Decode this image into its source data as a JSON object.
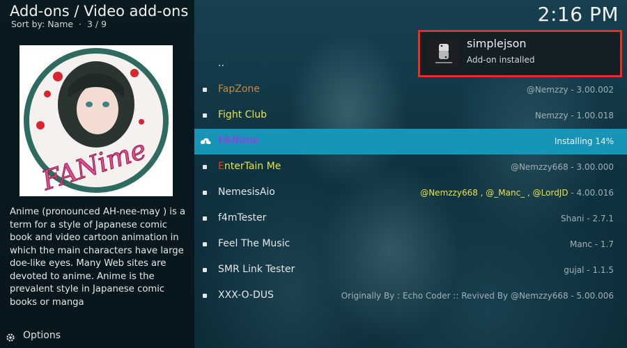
{
  "header": {
    "title": "Add-ons / Video add-ons",
    "sort_label": "Sort by: Name",
    "position": "3 / 9"
  },
  "clock": "2:16 PM",
  "notification": {
    "title": "simplejson",
    "message": "Add-on installed",
    "icon": "python-icon"
  },
  "addon_image": {
    "icon": "fanime-artwork",
    "logo_text": "FANime"
  },
  "description": "Anime (pronounced AH-nee-may ) is a term for a style of Japanese comic book and video cartoon animation in which the main characters have large doe-like eyes. Many Web sites are devoted to anime. Anime is the prevalent style in Japanese comic books or manga",
  "options": {
    "label": "Options",
    "icon": "options-gear-icon"
  },
  "list": {
    "parent": "..",
    "items": [
      {
        "name_a": "F",
        "name_b": "apZone",
        "meta": "@Nemzzy - 3.00.002"
      },
      {
        "name_a": "F",
        "name_b": "ight Club",
        "meta": "Nemzzy - 1.00.018"
      },
      {
        "name_a": "FAN",
        "name_b": "ime",
        "meta": "Installing 14%"
      },
      {
        "name_a": "E",
        "name_b": "nterTain Me",
        "meta": "@Nemzzy668 - 3.00.000"
      },
      {
        "name_a": "NemesisAio",
        "name_b": "",
        "meta_a": "@Nemzzy668 , @_Manc_ , @LordJD",
        "meta_b": " - 4.00.016"
      },
      {
        "name_a": "f4mTester",
        "name_b": "",
        "meta": "Shani - 2.7.1"
      },
      {
        "name_a": "Feel The Music",
        "name_b": "",
        "meta": "Manc - 1.7"
      },
      {
        "name_a": "SMR Link Tester",
        "name_b": "",
        "meta": "gujal - 1.1.5"
      },
      {
        "name_a": "XXX-O-DUS",
        "name_b": "",
        "meta": "Originally By : Echo Coder :: Revived By @Nemzzy668 - 5.00.006"
      }
    ]
  },
  "colors": {
    "selected_row": "#1695b9",
    "notification_border": "#ef2b1f",
    "yellow_label": "#e8e34a"
  }
}
